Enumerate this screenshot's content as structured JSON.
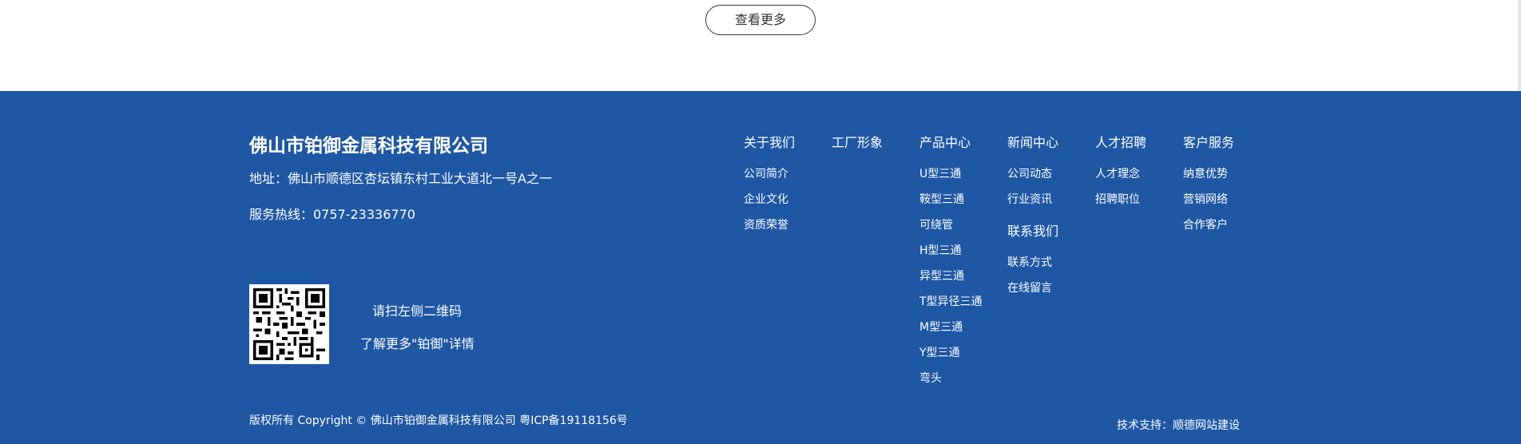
{
  "top": {
    "more_button": "查看更多"
  },
  "company": {
    "name": "佛山市铂御金属科技有限公司",
    "address": "地址：佛山市顺德区杏坛镇东村工业大道北一号A之一",
    "hotline": "服务热线：0757-23336770"
  },
  "qr": {
    "text1": "请扫左侧二维码",
    "text2": "了解更多\"铂御\"详情"
  },
  "nav": {
    "about": {
      "title": "关于我们",
      "items": [
        "公司简介",
        "企业文化",
        "资质荣誉"
      ]
    },
    "factory": {
      "title": "工厂形象"
    },
    "products": {
      "title": "产品中心",
      "items": [
        "U型三通",
        "鞍型三通",
        "可绕管",
        "H型三通",
        "异型三通",
        "T型异径三通",
        "M型三通",
        "Y型三通",
        "弯头"
      ]
    },
    "news": {
      "title": "新闻中心",
      "items": [
        "公司动态",
        "行业资讯"
      ]
    },
    "contact": {
      "title": "联系我们",
      "items": [
        "联系方式",
        "在线留言"
      ]
    },
    "careers": {
      "title": "人才招聘",
      "items": [
        "人才理念",
        "招聘职位"
      ]
    },
    "service": {
      "title": "客户服务",
      "items": [
        "纳意优势",
        "营销网络",
        "合作客户"
      ]
    }
  },
  "footer": {
    "copyright": "版权所有 Copyright © 佛山市铂御金属科技有限公司  粤ICP备19118156号",
    "tech_support": "技术支持：顺德网站建设"
  },
  "colors": {
    "footer_bg": "#1e57a4",
    "text": "#ffffff"
  }
}
